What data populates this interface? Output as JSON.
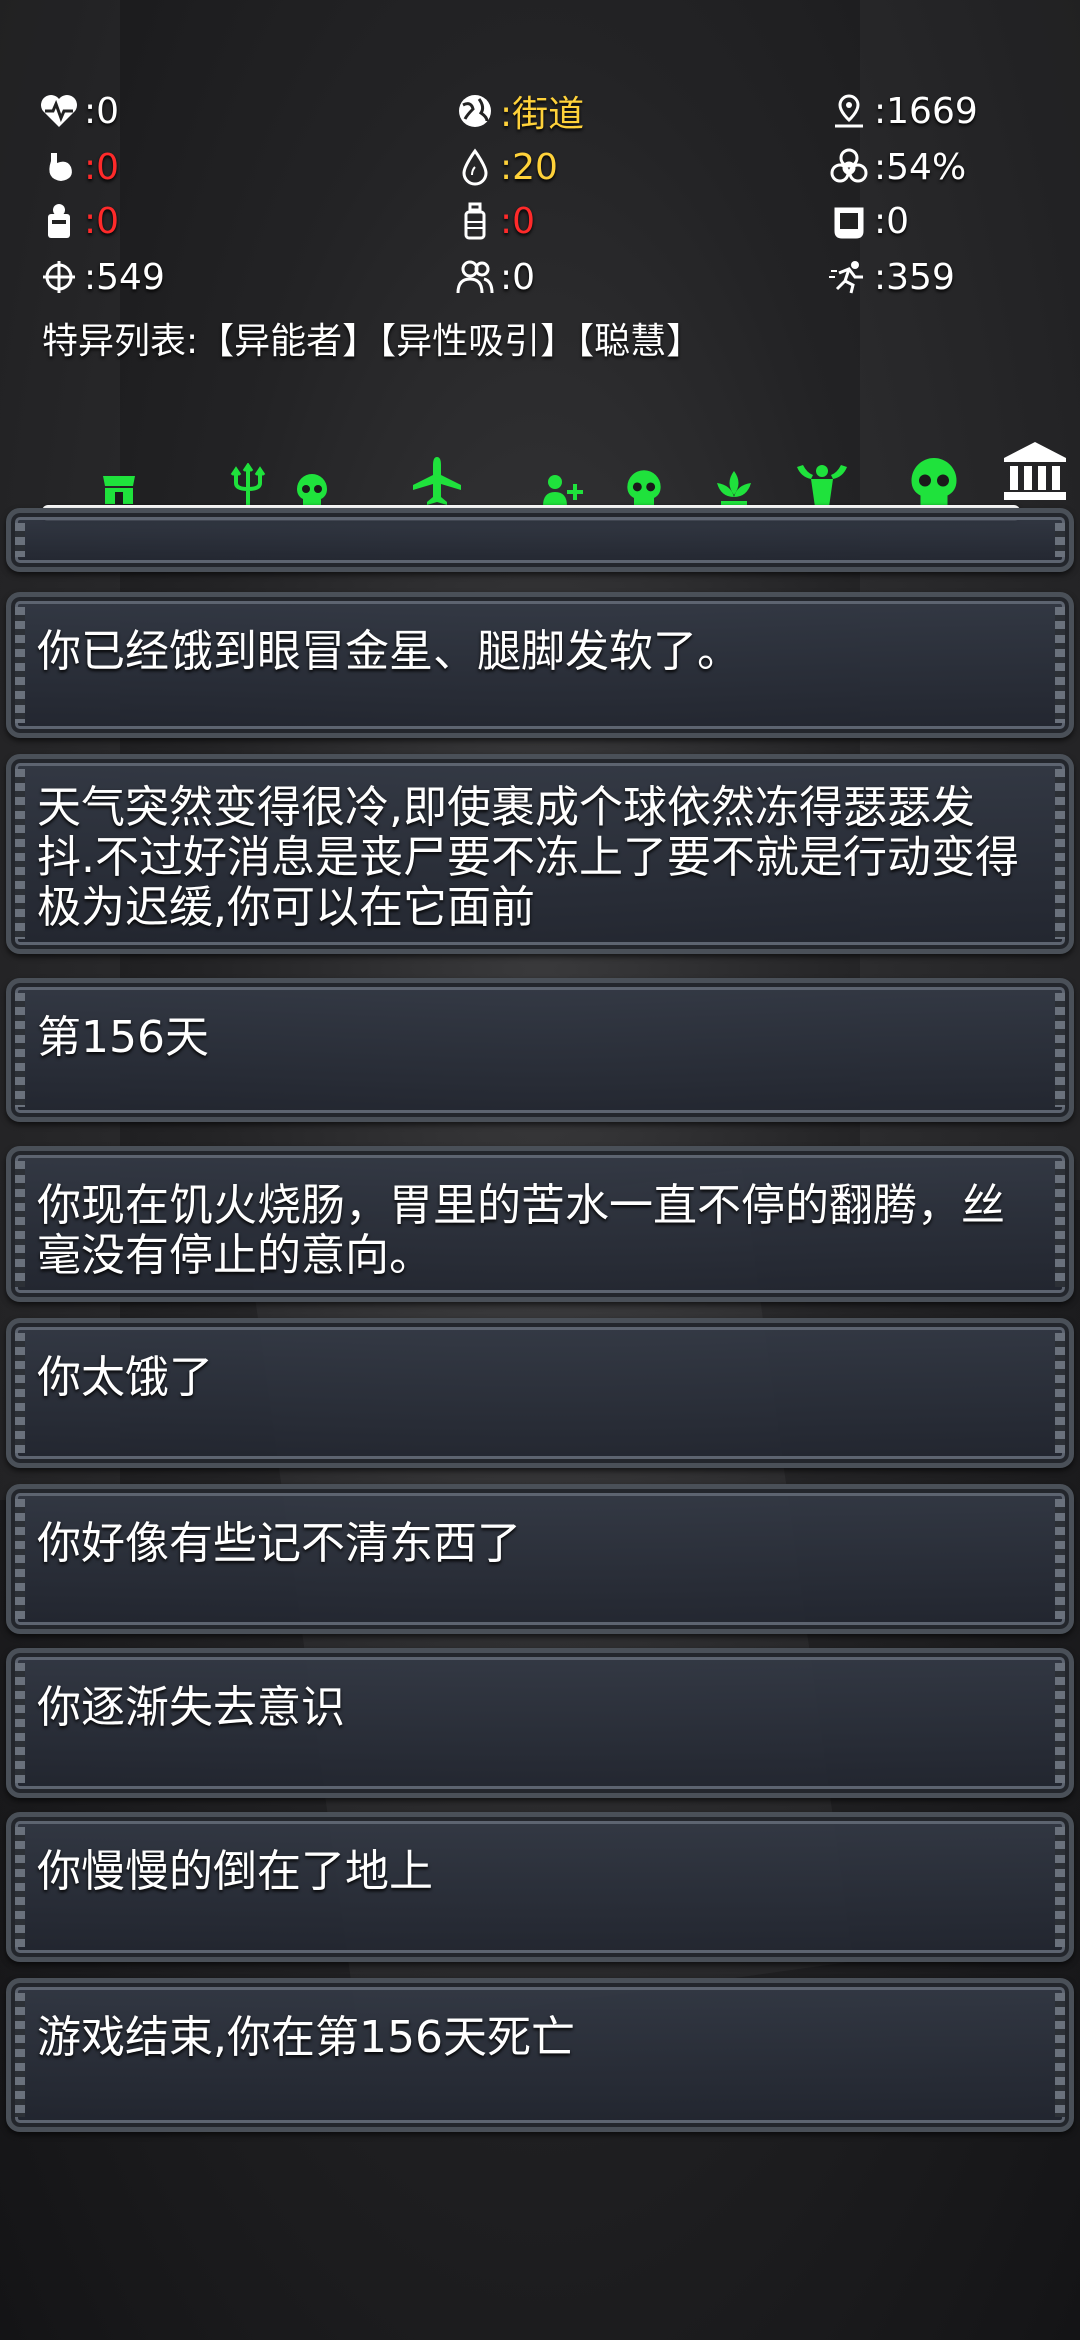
{
  "stats": [
    {
      "icon": "heart-pulse-icon",
      "value": ":0",
      "color": "#ffffff"
    },
    {
      "icon": "globe-icon",
      "value": ":街道",
      "color": "#ffd23a"
    },
    {
      "icon": "map-pin-icon",
      "value": ":1669",
      "color": "#ffffff"
    },
    {
      "icon": "stomach-icon",
      "value": ":0",
      "color": "#ff2a2a"
    },
    {
      "icon": "water-drop-icon",
      "value": ":20",
      "color": "#ffd23a"
    },
    {
      "icon": "biohazard-icon",
      "value": ":54%",
      "color": "#ffffff"
    },
    {
      "icon": "food-icon",
      "value": ":0",
      "color": "#ff2a2a"
    },
    {
      "icon": "bottle-icon",
      "value": ":0",
      "color": "#ff2a2a"
    },
    {
      "icon": "bucket-icon",
      "value": ":0",
      "color": "#ffffff"
    },
    {
      "icon": "crosshair-icon",
      "value": ":549",
      "color": "#ffffff"
    },
    {
      "icon": "people-icon",
      "value": ":0",
      "color": "#ffffff"
    },
    {
      "icon": "running-icon",
      "value": ":359",
      "color": "#ffffff"
    }
  ],
  "traits": "特异列表:【异能者】【异性吸引】【聪慧】",
  "progress": {
    "icons": [
      "shop-icon",
      "trident-icon",
      "skull-icon",
      "airplane-icon",
      "add-person-icon",
      "skull-icon",
      "lotus-icon",
      "strongman-icon",
      "skull-icon"
    ],
    "accent": "#1fe23c",
    "end_icon": "bank-icon"
  },
  "log": [
    "你已经饿到眼冒金星、腿脚发软了。",
    "天气突然变得很冷,即使裹成个球依然冻得瑟瑟发抖.不过好消息是丧尸要不冻上了要不就是行动变得极为迟缓,你可以在它面前",
    "第156天",
    "你现在饥火烧肠，胃里的苦水一直不停的翻腾，丝毫没有停止的意向。",
    "你太饿了",
    "你好像有些记不清东西了",
    "你逐渐失去意识",
    "你慢慢的倒在了地上",
    "游戏结束,你在第156天死亡"
  ]
}
